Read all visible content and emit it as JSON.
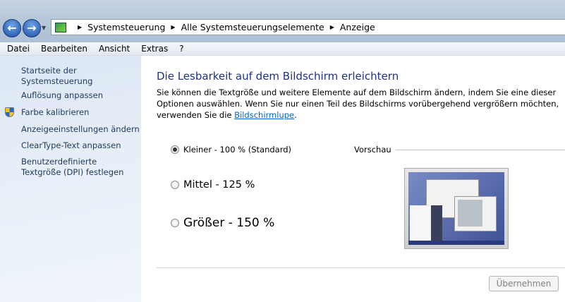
{
  "breadcrumb": [
    "Systemsteuerung",
    "Alle Systemsteuerungselemente",
    "Anzeige"
  ],
  "menu": [
    "Datei",
    "Bearbeiten",
    "Ansicht",
    "Extras",
    "?"
  ],
  "sidebar": {
    "items": [
      {
        "label": "Startseite der Systemsteuerung"
      },
      {
        "label": "Auflösung anpassen"
      },
      {
        "label": "Farbe kalibrieren",
        "icon": "uac-shield-icon"
      },
      {
        "label": "Anzeigeeinstellungen ändern"
      },
      {
        "label": "ClearType-Text anpassen"
      },
      {
        "label": "Benutzerdefinierte Textgröße (DPI) festlegen"
      }
    ]
  },
  "main": {
    "title": "Die Lesbarkeit auf dem Bildschirm erleichtern",
    "desc": "Sie können die Textgröße und weitere Elemente auf dem Bildschirm ändern, indem Sie eine dieser Optionen auswählen. Wenn Sie nur einen Teil des Bildschirms vorübergehend vergrößern möchten, verwenden Sie die ",
    "desc_link": "Bildschirmlupe",
    "desc_end": ".",
    "options": [
      {
        "label": "Kleiner - 100 % (Standard)",
        "selected": true
      },
      {
        "label": "Mittel - 125 %",
        "selected": false
      },
      {
        "label": "Größer - 150 %",
        "selected": false
      }
    ],
    "preview_label": "Vorschau",
    "apply_label": "Übernehmen"
  },
  "colors": {
    "heading": "#1e3287",
    "link": "#0066cc",
    "sidebar_link": "#1e395b"
  }
}
